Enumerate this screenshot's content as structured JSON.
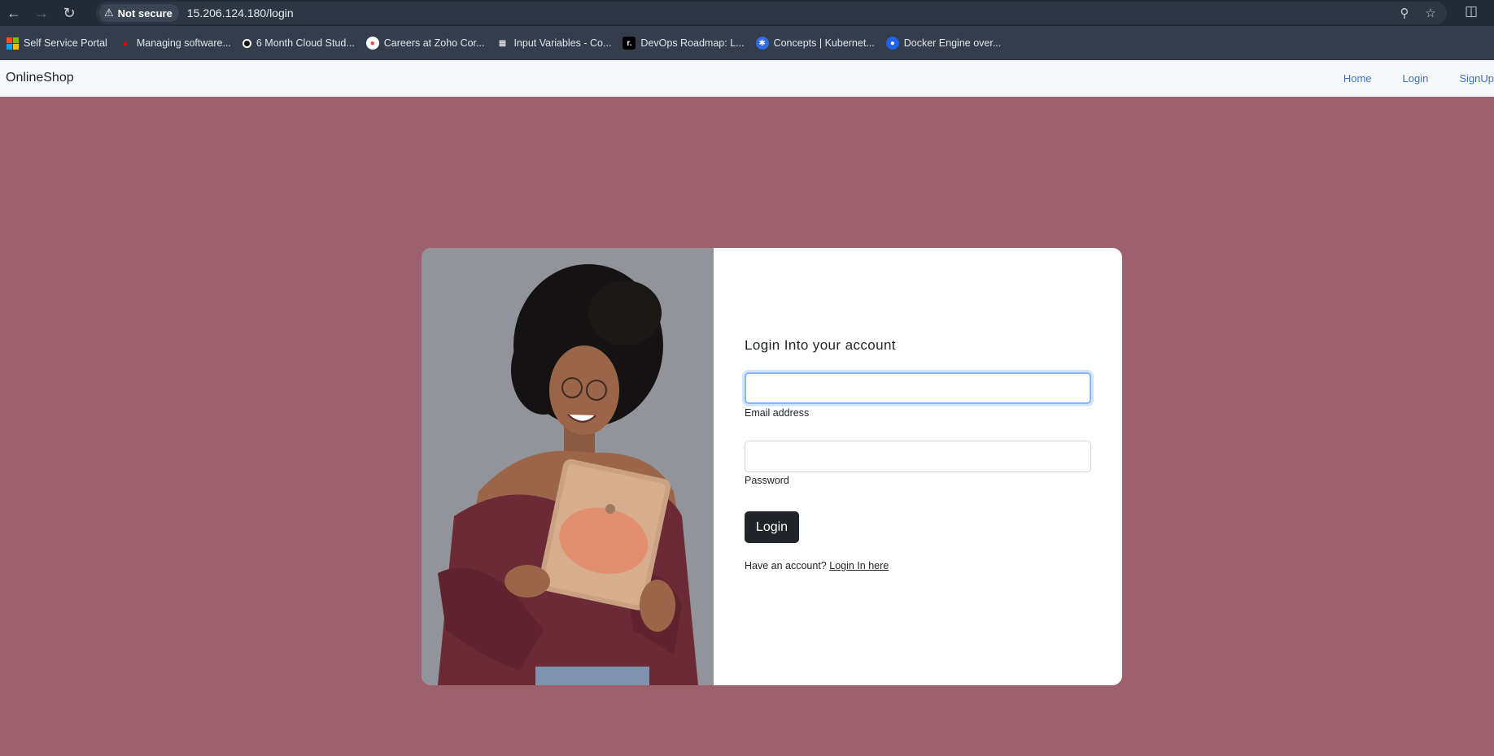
{
  "browser": {
    "security_label": "Not secure",
    "url": "15.206.124.180/login",
    "bookmarks": [
      {
        "label": "Self Service Portal",
        "icon": "microsoft-icon"
      },
      {
        "label": "Managing software...",
        "icon": "redhat-icon"
      },
      {
        "label": "6 Month Cloud Stud...",
        "icon": "circle-icon"
      },
      {
        "label": "Careers at Zoho Cor...",
        "icon": "zoho-icon"
      },
      {
        "label": "Input Variables - Co...",
        "icon": "terraform-icon"
      },
      {
        "label": "DevOps Roadmap: L...",
        "icon": "roadmap-icon"
      },
      {
        "label": "Concepts | Kubernet...",
        "icon": "kubernetes-icon"
      },
      {
        "label": "Docker Engine over...",
        "icon": "docker-icon"
      }
    ]
  },
  "navbar": {
    "brand": "OnlineShop",
    "links": [
      "Home",
      "Login",
      "SignUp"
    ]
  },
  "login_form": {
    "title": "Login Into your account",
    "email_value": "",
    "email_label": "Email address",
    "password_value": "",
    "password_label": "Password",
    "submit_label": "Login",
    "footer_text": "Have an account?",
    "footer_link": "Login In here"
  },
  "colors": {
    "page_background": "#9c616c",
    "navbar_background": "#f8f9fa",
    "link": "#3a6fd0",
    "button": "#212529"
  }
}
